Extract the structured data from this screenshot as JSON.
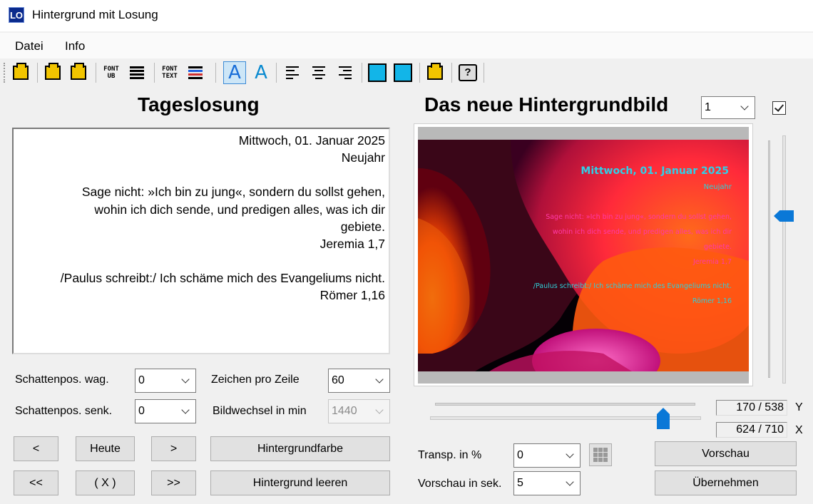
{
  "window": {
    "title": "Hintergrund mit Losung",
    "icon_text": "LO"
  },
  "menu": {
    "items": [
      "Datei",
      "Info"
    ]
  },
  "toolbar": {
    "font_ub_label": "FONT UB",
    "font_text_label": "FONT TEXT"
  },
  "left": {
    "heading": "Tageslosung",
    "text": {
      "date": "Mittwoch, 01. Januar 2025",
      "holiday": "Neujahr",
      "verse_line1": "Sage nicht: »Ich bin zu jung«, sondern du sollst gehen,",
      "verse_line2": "wohin ich dich sende, und predigen alles, was ich dir",
      "verse_line3": "gebiete.",
      "verse_ref": "Jeremia 1,7",
      "lehrtext": "/Paulus schreibt:/ Ich schäme mich des Evangeliums nicht.",
      "lehrtext_ref": "Römer 1,16"
    },
    "shadow_h_label": "Schattenpos. wag.",
    "shadow_h_value": "0",
    "shadow_v_label": "Schattenpos. senk.",
    "shadow_v_value": "0",
    "chars_label": "Zeichen pro Zeile",
    "chars_value": "60",
    "interval_label": "Bildwechsel in min",
    "interval_value": "1440",
    "buttons": {
      "prev": "<",
      "today": "Heute",
      "next": ">",
      "bgcolor": "Hintergrundfarbe",
      "prev_prev": "<<",
      "clear_x": "( X )",
      "next_next": ">>",
      "bg_clear": "Hintergrund leeren"
    }
  },
  "right": {
    "heading": "Das neue Hintergrundbild",
    "monitor_value": "1",
    "checkbox_checked": true,
    "preview": {
      "date": "Mittwoch, 01. Januar 2025",
      "holiday": "Neujahr",
      "verse_line1": "Sage nicht: »Ich bin zu jung«, sondern du sollst gehen,",
      "verse_line2": "wohin ich dich sende, und predigen alles, was ich dir",
      "verse_line3": "gebiete.",
      "verse_ref": "Jeremia 1,7",
      "lehrtext": "/Paulus schreibt:/ Ich schäme mich des Evangeliums nicht.",
      "lehrtext_ref": "Römer 1,16"
    },
    "y_coord": "170 / 538",
    "y_label": "Y",
    "x_coord": "624 / 710",
    "x_label": "X",
    "transp_label": "Transp. in %",
    "transp_value": "0",
    "preview_secs_label": "Vorschau in sek.",
    "preview_secs_value": "5",
    "btn_preview": "Vorschau",
    "btn_apply": "Übernehmen",
    "colors": {
      "title_cyan": "#2fd0e8",
      "text_pink": "#ff3aa8",
      "text_cyan": "#2fd0d8"
    }
  }
}
